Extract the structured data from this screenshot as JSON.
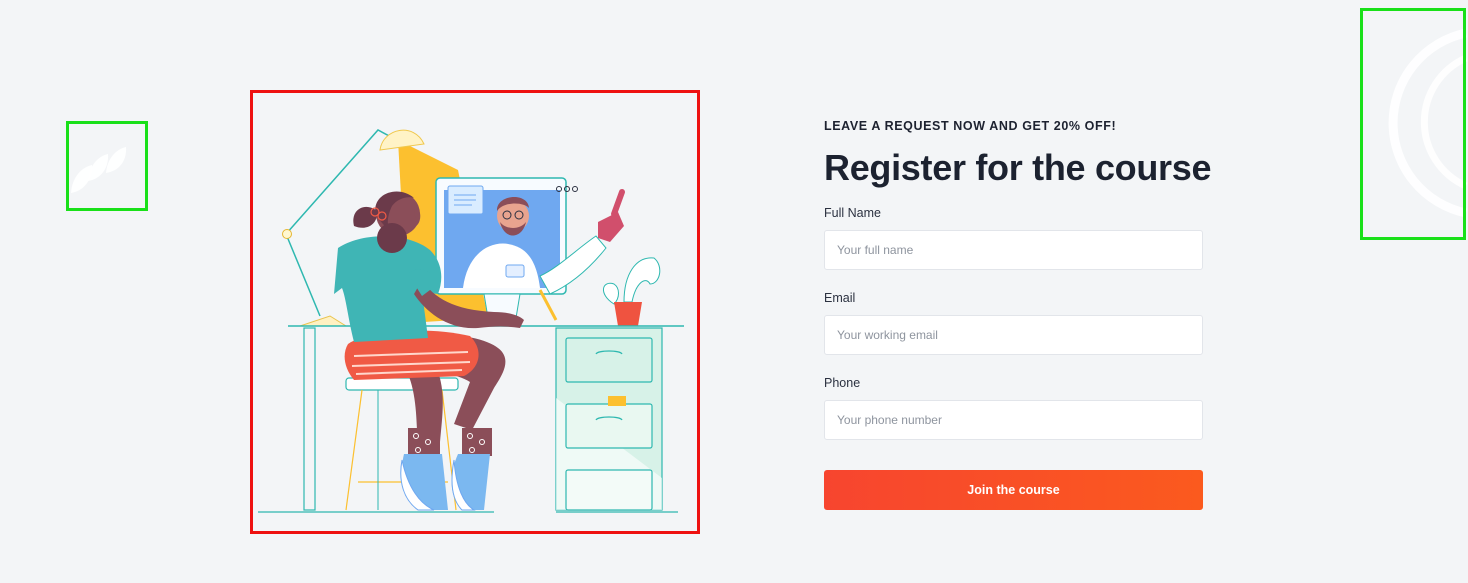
{
  "promo": {
    "text": "LEAVE A REQUEST NOW AND GET 20% OFF!"
  },
  "form": {
    "title": "Register for the course",
    "fields": [
      {
        "label": "Full Name",
        "placeholder": "Your full name",
        "value": ""
      },
      {
        "label": "Email",
        "placeholder": "Your working email",
        "value": ""
      },
      {
        "label": "Phone",
        "placeholder": "Your phone number",
        "value": ""
      }
    ],
    "submit_label": "Join the course"
  },
  "illustration": {
    "subject": "online-learning-desk-illustration"
  },
  "colors": {
    "background": "#f3f5f7",
    "accent_start": "#f7452f",
    "accent_end": "#fb5a1e",
    "heading": "#1c2230",
    "frame_green": "#19e019",
    "frame_red": "#ee1111"
  }
}
